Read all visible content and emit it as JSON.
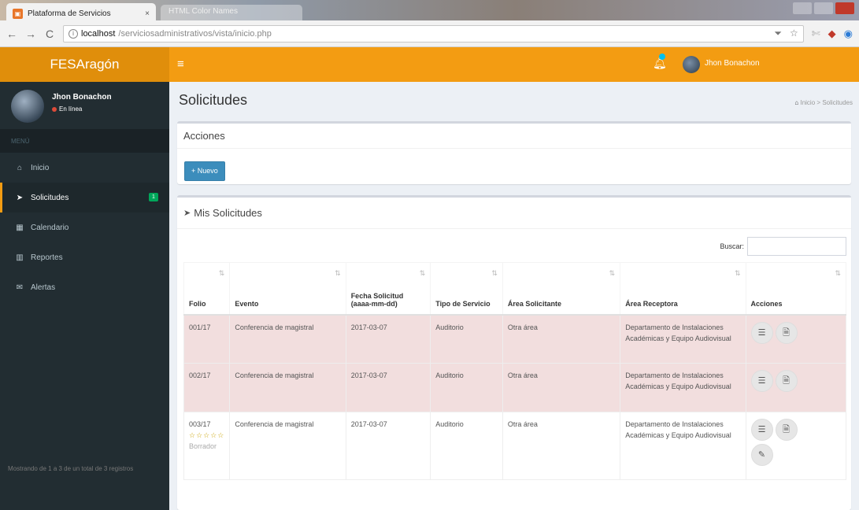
{
  "browser": {
    "tabs": [
      {
        "title": "Plataforma de Servicios",
        "close": "×"
      },
      {
        "title": "HTML Color Names"
      }
    ],
    "address": {
      "host": "localhost",
      "path": "/serviciosadministrativos/vista/inicio.php"
    },
    "nav": {
      "back": "←",
      "forward": "→",
      "reload": "C"
    }
  },
  "app": {
    "logo": "FESAragón",
    "header_user": "Jhon Bonachon"
  },
  "sidebar": {
    "user_name": "Jhon Bonachon",
    "user_status": "En línea",
    "menu_header": "MENÚ",
    "items": [
      {
        "label": "Inicio",
        "icon": "home-icon"
      },
      {
        "label": "Solicitudes",
        "icon": "paper-plane-icon",
        "badge": "1"
      },
      {
        "label": "Calendario",
        "icon": "calendar-icon"
      },
      {
        "label": "Reportes",
        "icon": "bar-chart-icon"
      },
      {
        "label": "Alertas",
        "icon": "envelope-icon"
      }
    ]
  },
  "page": {
    "title": "Solicitudes",
    "breadcrumb": {
      "home": "Inicio",
      "separator": ">",
      "current": "Solicitudes"
    }
  },
  "actions_box": {
    "title": "Acciones",
    "new_button": "+ Nuevo"
  },
  "list_box": {
    "title": "Mis Solicitudes",
    "search_label": "Buscar:",
    "search_value": "",
    "columns": [
      {
        "label": "Folio"
      },
      {
        "label": "Evento"
      },
      {
        "label": "Fecha Solicitud (aaaa-mm-dd)"
      },
      {
        "label": "Tipo de Servicio"
      },
      {
        "label": "Área Solicitante"
      },
      {
        "label": "Área Receptora"
      },
      {
        "label": "Acciones"
      }
    ],
    "rows": [
      {
        "folio": "001/17",
        "evento": "Conferencia de magistral",
        "fecha": "2017-03-07",
        "tipo": "Auditorio",
        "solicitante": "Otra área",
        "receptora": "Departamento de Instalaciones Académicas y Equipo Audiovisual",
        "status": "highlight"
      },
      {
        "folio": "002/17",
        "evento": "Conferencia de magistral",
        "fecha": "2017-03-07",
        "tipo": "Auditorio",
        "solicitante": "Otra área",
        "receptora": "Departamento de Instalaciones Académicas y Equipo Audiovisual",
        "status": "highlight"
      },
      {
        "folio": "003/17",
        "stars": "☆☆☆☆☆",
        "draft": "Borrador",
        "evento": "Conferencia de magistral",
        "fecha": "2017-03-07",
        "tipo": "Auditorio",
        "solicitante": "Otra área",
        "receptora": "Departamento de Instalaciones Académicas y Equipo Audiovisual",
        "status": "normal"
      }
    ],
    "footer": "Mostrando de 1 a 3 de un total de 3 registros"
  },
  "colors": {
    "header": "#f39c12",
    "logo_bg": "#e08e0b",
    "sidebar": "#222d32",
    "primary_button": "#3c8dbc",
    "row_highlight": "#f2dede",
    "badge": "#00a65a"
  }
}
